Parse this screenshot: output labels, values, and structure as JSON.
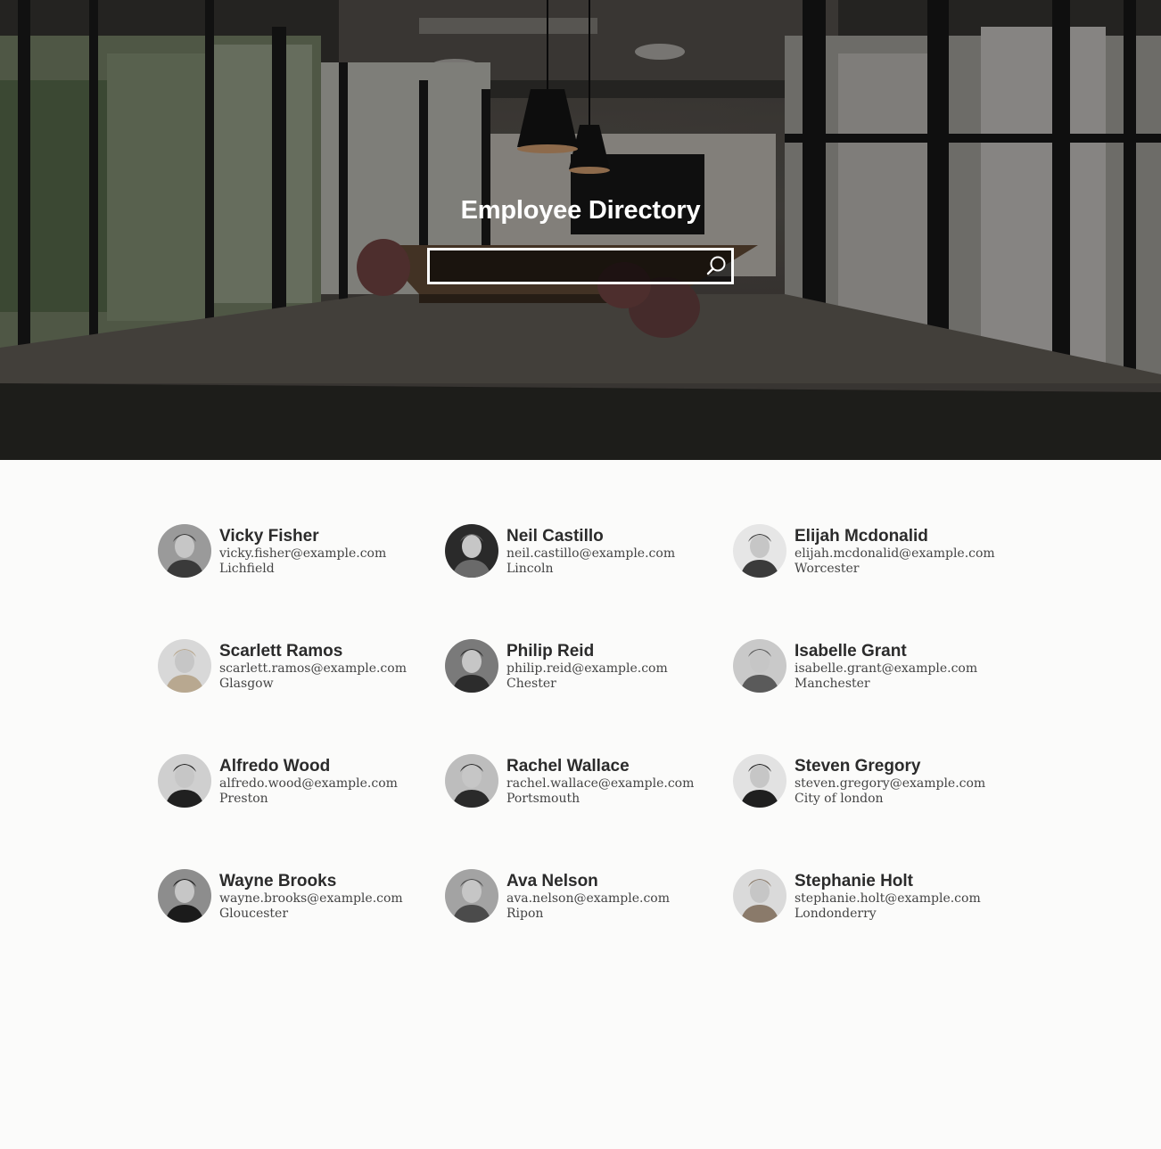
{
  "header": {
    "title": "Employee Directory",
    "search_value": "",
    "search_icon": "search-icon"
  },
  "employees": [
    {
      "name": "Vicky Fisher",
      "email": "vicky.fisher@example.com",
      "city": "Lichfield"
    },
    {
      "name": "Neil Castillo",
      "email": "neil.castillo@example.com",
      "city": "Lincoln"
    },
    {
      "name": "Elijah Mcdonalid",
      "email": "elijah.mcdonalid@example.com",
      "city": "Worcester"
    },
    {
      "name": "Scarlett Ramos",
      "email": "scarlett.ramos@example.com",
      "city": "Glasgow"
    },
    {
      "name": "Philip Reid",
      "email": "philip.reid@example.com",
      "city": "Chester"
    },
    {
      "name": "Isabelle Grant",
      "email": "isabelle.grant@example.com",
      "city": "Manchester"
    },
    {
      "name": "Alfredo Wood",
      "email": "alfredo.wood@example.com",
      "city": "Preston"
    },
    {
      "name": "Rachel Wallace",
      "email": "rachel.wallace@example.com",
      "city": "Portsmouth"
    },
    {
      "name": "Steven Gregory",
      "email": "steven.gregory@example.com",
      "city": "City of london"
    },
    {
      "name": "Wayne Brooks",
      "email": "wayne.brooks@example.com",
      "city": "Gloucester"
    },
    {
      "name": "Ava Nelson",
      "email": "ava.nelson@example.com",
      "city": "Ripon"
    },
    {
      "name": "Stephanie Holt",
      "email": "stephanie.holt@example.com",
      "city": "Londonderry"
    }
  ]
}
